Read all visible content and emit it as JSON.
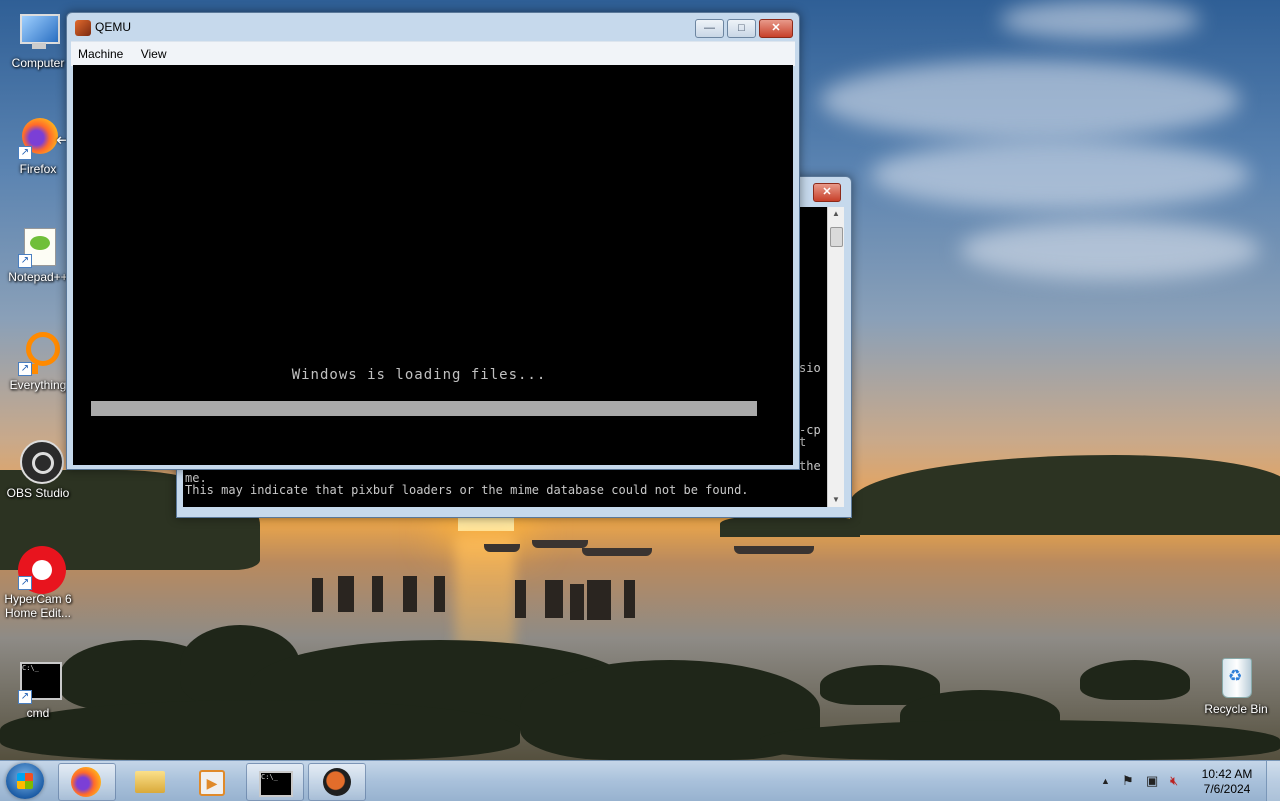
{
  "desktop": {
    "icons": [
      {
        "label": "Computer"
      },
      {
        "label": "Firefox"
      },
      {
        "label": "Notepad++"
      },
      {
        "label": "Everything"
      },
      {
        "label": "OBS Studio"
      },
      {
        "label": "HyperCam 6 Home Edit..."
      },
      {
        "label": "cmd"
      },
      {
        "label": "Recycle Bin"
      }
    ]
  },
  "qemu": {
    "title": "QEMU",
    "menu": [
      "Machine",
      "View"
    ],
    "controls": {
      "minimize": "—",
      "maximize": "□",
      "close": "✕"
    },
    "boot_text": "Windows is loading files...",
    "progress": 1.0
  },
  "console": {
    "close": "✕",
    "line_sio": "sio",
    "line_cp": "-cp",
    "line_t": "t",
    "line_the": "the",
    "line_me": "me.",
    "line_main": "This may indicate that pixbuf loaders or the mime database could not be found.",
    "scroll_up": "▲",
    "scroll_down": "▼"
  },
  "taskbar": {
    "time": "10:42 AM",
    "date": "7/6/2024",
    "tray_expand": "▲",
    "colors": {
      "accent": "#1d5da6",
      "close_red": "#c7402a"
    }
  }
}
